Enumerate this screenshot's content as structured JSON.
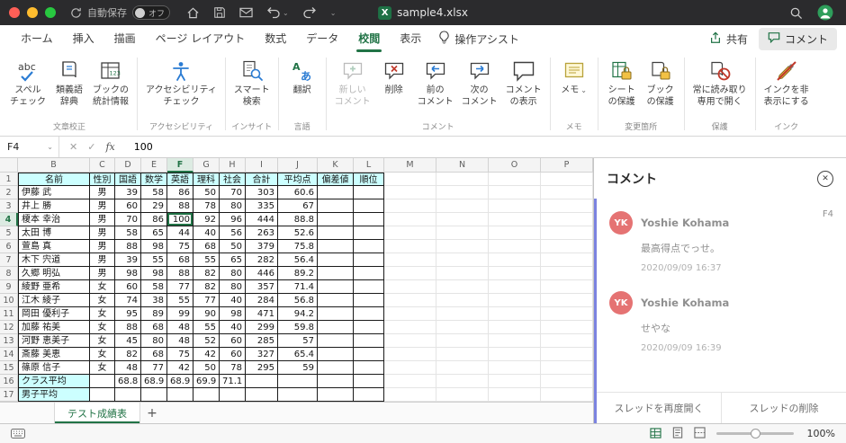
{
  "colors": {
    "accent_green": "#217346",
    "table_header_fill": "#ccffff",
    "avatar_fill": "#e57373",
    "thread_accent": "#7b83e0",
    "traffic_red": "#ff5f57",
    "traffic_yellow": "#febc2e",
    "traffic_green": "#28c840"
  },
  "titlebar": {
    "autosave_label": "自動保存",
    "autosave_state": "オフ",
    "excel_icon_letter": "X",
    "filename": "sample4.xlsx"
  },
  "tabs_row": {
    "tabs": [
      {
        "label": "ホーム",
        "active": false
      },
      {
        "label": "挿入",
        "active": false
      },
      {
        "label": "描画",
        "active": false
      },
      {
        "label": "ページ レイアウト",
        "active": false
      },
      {
        "label": "数式",
        "active": false
      },
      {
        "label": "データ",
        "active": false
      },
      {
        "label": "校閲",
        "active": true
      },
      {
        "label": "表示",
        "active": false
      }
    ],
    "assistant_label": "操作アシスト",
    "share_label": "共有",
    "comments_label": "コメント"
  },
  "ribbon": {
    "groups": [
      {
        "label": "文章校正",
        "buttons": [
          {
            "name": "spell-check-button",
            "icon": "spellcheck-icon",
            "lines": [
              "スペル",
              "チェック"
            ]
          },
          {
            "name": "thesaurus-button",
            "icon": "thesaurus-icon",
            "lines": [
              "類義語",
              "辞典"
            ]
          },
          {
            "name": "workbook-stats-button",
            "icon": "workbook-stats-icon",
            "lines": [
              "ブックの",
              "統計情報"
            ]
          }
        ]
      },
      {
        "label": "アクセシビリティ",
        "buttons": [
          {
            "name": "accessibility-check-button",
            "icon": "accessibility-icon",
            "lines": [
              "アクセシビリティ",
              "チェック"
            ]
          }
        ]
      },
      {
        "label": "インサイト",
        "buttons": [
          {
            "name": "smart-lookup-button",
            "icon": "smart-lookup-icon",
            "lines": [
              "スマート",
              "検索"
            ]
          }
        ]
      },
      {
        "label": "言語",
        "buttons": [
          {
            "name": "translate-button",
            "icon": "translate-icon",
            "lines": [
              "翻訳"
            ]
          }
        ]
      },
      {
        "label": "コメント",
        "buttons": [
          {
            "name": "new-comment-button",
            "icon": "new-comment-icon",
            "lines": [
              "新しい",
              "コメント"
            ],
            "disabled": true
          },
          {
            "name": "delete-comment-button",
            "icon": "delete-comment-icon",
            "lines": [
              "削除"
            ]
          },
          {
            "name": "previous-comment-button",
            "icon": "previous-comment-icon",
            "lines": [
              "前の",
              "コメント"
            ]
          },
          {
            "name": "next-comment-button",
            "icon": "next-comment-icon",
            "lines": [
              "次の",
              "コメント"
            ]
          },
          {
            "name": "show-comments-button",
            "icon": "show-comments-icon",
            "lines": [
              "コメント",
              "の表示"
            ]
          }
        ]
      },
      {
        "label": "メモ",
        "buttons": [
          {
            "name": "notes-button",
            "icon": "note-icon",
            "lines": [
              "メモ"
            ],
            "dropdown": true
          }
        ]
      },
      {
        "label": "変更箇所",
        "buttons": [
          {
            "name": "protect-sheet-button",
            "icon": "protect-sheet-icon",
            "lines": [
              "シート",
              "の保護"
            ]
          },
          {
            "name": "protect-workbook-button",
            "icon": "protect-workbook-icon",
            "lines": [
              "ブック",
              "の保護"
            ]
          }
        ]
      },
      {
        "label": "保護",
        "buttons": [
          {
            "name": "always-read-only-button",
            "icon": "read-only-icon",
            "lines": [
              "常に読み取り",
              "専用で開く"
            ]
          }
        ]
      },
      {
        "label": "インク",
        "buttons": [
          {
            "name": "hide-ink-button",
            "icon": "hide-ink-icon",
            "lines": [
              "インクを非",
              "表示にする"
            ]
          }
        ]
      }
    ]
  },
  "formula_bar": {
    "name_box": "F4",
    "fx_label": "fx",
    "value": "100"
  },
  "grid": {
    "column_letters": [
      "B",
      "C",
      "D",
      "E",
      "F",
      "G",
      "H",
      "I",
      "J",
      "K",
      "L",
      "M",
      "N",
      "O",
      "P"
    ],
    "selected_column": "F",
    "selected_row": 4,
    "header_row": [
      "名前",
      "性別",
      "国語",
      "数学",
      "英語",
      "理科",
      "社会",
      "合計",
      "平均点",
      "偏差値",
      "順位"
    ],
    "students": [
      {
        "row": 2,
        "name": "伊藤 武",
        "gender": "男",
        "scores": [
          "39",
          "58",
          "86",
          "50",
          "70"
        ],
        "total": "303",
        "average": "60.6"
      },
      {
        "row": 3,
        "name": "井上 勝",
        "gender": "男",
        "scores": [
          "60",
          "29",
          "88",
          "78",
          "80"
        ],
        "total": "335",
        "average": "67"
      },
      {
        "row": 4,
        "name": "榎本 幸治",
        "gender": "男",
        "scores": [
          "70",
          "86",
          "100",
          "92",
          "96"
        ],
        "total": "444",
        "average": "88.8"
      },
      {
        "row": 5,
        "name": "太田 博",
        "gender": "男",
        "scores": [
          "58",
          "65",
          "44",
          "40",
          "56"
        ],
        "total": "263",
        "average": "52.6"
      },
      {
        "row": 6,
        "name": "萱島 真",
        "gender": "男",
        "scores": [
          "88",
          "98",
          "75",
          "68",
          "50"
        ],
        "total": "379",
        "average": "75.8"
      },
      {
        "row": 7,
        "name": "木下 宍道",
        "gender": "男",
        "scores": [
          "39",
          "55",
          "68",
          "55",
          "65"
        ],
        "total": "282",
        "average": "56.4"
      },
      {
        "row": 8,
        "name": "久郷 明弘",
        "gender": "男",
        "scores": [
          "98",
          "98",
          "88",
          "82",
          "80"
        ],
        "total": "446",
        "average": "89.2"
      },
      {
        "row": 9,
        "name": "綾野 亜希",
        "gender": "女",
        "scores": [
          "60",
          "58",
          "77",
          "82",
          "80"
        ],
        "total": "357",
        "average": "71.4"
      },
      {
        "row": 10,
        "name": "江木 綾子",
        "gender": "女",
        "scores": [
          "74",
          "38",
          "55",
          "77",
          "40"
        ],
        "total": "284",
        "average": "56.8"
      },
      {
        "row": 11,
        "name": "岡田 優利子",
        "gender": "女",
        "scores": [
          "95",
          "89",
          "99",
          "90",
          "98"
        ],
        "total": "471",
        "average": "94.2"
      },
      {
        "row": 12,
        "name": "加藤 祐美",
        "gender": "女",
        "scores": [
          "88",
          "68",
          "48",
          "55",
          "40"
        ],
        "total": "299",
        "average": "59.8"
      },
      {
        "row": 13,
        "name": "河野 恵美子",
        "gender": "女",
        "scores": [
          "45",
          "80",
          "48",
          "52",
          "60"
        ],
        "total": "285",
        "average": "57"
      },
      {
        "row": 14,
        "name": "斎藤 美恵",
        "gender": "女",
        "scores": [
          "82",
          "68",
          "75",
          "42",
          "60"
        ],
        "total": "327",
        "average": "65.4"
      },
      {
        "row": 15,
        "name": "篠原 信子",
        "gender": "女",
        "scores": [
          "48",
          "77",
          "42",
          "50",
          "78"
        ],
        "total": "295",
        "average": "59"
      }
    ],
    "summary_rows": [
      {
        "row": 16,
        "label": "クラス平均",
        "values": [
          "68.8",
          "68.9",
          "68.9",
          "69.9",
          "71.1"
        ]
      },
      {
        "row": 17,
        "label": "男子平均",
        "values": []
      }
    ]
  },
  "comments_pane": {
    "title": "コメント",
    "thread": {
      "cell_ref": "F4",
      "comments": [
        {
          "initials": "YK",
          "author": "Yoshie Kohama",
          "text": "最高得点でっせ。",
          "timestamp": "2020/09/09 16:37"
        },
        {
          "initials": "YK",
          "author": "Yoshie Kohama",
          "text": "せやな",
          "timestamp": "2020/09/09 16:39"
        }
      ],
      "reopen_label": "スレッドを再度開く",
      "delete_label": "スレッドの削除"
    }
  },
  "sheet_tabs": {
    "tabs": [
      {
        "label": "テスト成績表",
        "active": true
      }
    ],
    "add_label": "+"
  },
  "status_bar": {
    "zoom_label": "100%"
  }
}
